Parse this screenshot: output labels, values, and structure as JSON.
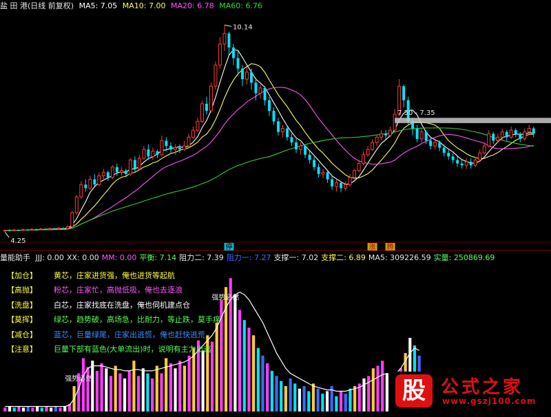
{
  "price_header": {
    "title": "盐 田 港(日线 前复权)",
    "ma5": "MA5: 7.05",
    "ma10": "MA10: 7.00",
    "ma20": "MA20: 6.78",
    "ma60": "MA60: 6.76"
  },
  "volume_header": {
    "title": "量能助手",
    "items": [
      {
        "text": "JJJ: 0.00",
        "color": "#e6e6e6"
      },
      {
        "text": "XX: 0.00",
        "color": "#e6e6e6"
      },
      {
        "text": "MM: 0.00",
        "color": "#ff55ff"
      },
      {
        "text": "平衡: 7.14",
        "color": "#55ff55"
      },
      {
        "text": "阻力二: 7.39",
        "color": "#e6e6e6"
      },
      {
        "text": "阻力一: 7.27",
        "color": "#3b6cff"
      },
      {
        "text": "支撑一: 7.02",
        "color": "#e6e6e6"
      },
      {
        "text": "支撑二: 6.89",
        "color": "#ffff55"
      },
      {
        "text": "MA5: 309226.59",
        "color": "#e6e6e6"
      },
      {
        "text": "实量: 250869.69",
        "color": "#55ff55"
      }
    ]
  },
  "legend": [
    {
      "tag": "【加仓】",
      "text": "黄芯，庄家进货强，俺也进货等起航",
      "color": "#ffff33"
    },
    {
      "tag": "【高抛】",
      "text": "粉芯，庄家忙，高抛低吸，俺也去逐浪",
      "color": "#ff55ff"
    },
    {
      "tag": "【洗盘】",
      "text": "白芯，庄家找底在洗盘，俺也伺机建点仓",
      "color": "#ffffff"
    },
    {
      "tag": "【莫挥】",
      "text": "绿芯，趋势破，高场急，比耐力，等止跌，莫手痒",
      "color": "#55ff55"
    },
    {
      "tag": "【减仓】",
      "text": "蓝芯，巨量绿尾，庄家出逃慌，俺也赶快逃荒",
      "color": "#3b8cff"
    },
    {
      "tag": "【注意】",
      "text": "巨量下部有蓝色(大单流出)时，说明有主力出逃",
      "color": "#55ff55"
    }
  ],
  "annotations": {
    "high_label": "10.14",
    "low_label": "4.25",
    "resistance_label": "7.50 - 7.35",
    "stop_mark": "停",
    "limit_marks": [
      "涨",
      "腾"
    ],
    "vol_note_1": "强势必然",
    "vol_note_2": "强势必然"
  },
  "logo": {
    "stamp": "股",
    "name": "公式之家",
    "url": "www.gszj100.com"
  },
  "colors": {
    "up": "#ff3c3c",
    "down": "#00e5ff",
    "ma5": "#ffffff",
    "ma10": "#ffff55",
    "ma20": "#ff55ff",
    "ma60": "#33cc33",
    "resistance": "#c8c8c8"
  },
  "chart_data": [
    {
      "type": "candlestick",
      "title": "盐 田 港(日线 前复权)",
      "ylim": [
        4.0,
        10.5
      ],
      "ma_periods": [
        5,
        10,
        20,
        60
      ],
      "resistance_band": [
        7.35,
        7.5
      ],
      "marked_high": 10.14,
      "marked_low": 4.25,
      "candles": [
        [
          4.28,
          4.3,
          4.32,
          4.25
        ],
        [
          4.3,
          4.29,
          4.33,
          4.27
        ],
        [
          4.29,
          4.31,
          4.34,
          4.27
        ],
        [
          4.31,
          4.3,
          4.33,
          4.28
        ],
        [
          4.3,
          4.32,
          4.35,
          4.28
        ],
        [
          4.32,
          4.31,
          4.34,
          4.29
        ],
        [
          4.31,
          4.33,
          4.36,
          4.29
        ],
        [
          4.33,
          4.32,
          4.35,
          4.3
        ],
        [
          4.32,
          4.34,
          4.37,
          4.3
        ],
        [
          4.34,
          4.33,
          4.36,
          4.31
        ],
        [
          4.33,
          4.35,
          4.38,
          4.31
        ],
        [
          4.35,
          4.34,
          4.37,
          4.32
        ],
        [
          4.34,
          4.36,
          4.39,
          4.32
        ],
        [
          4.36,
          4.35,
          4.38,
          4.33
        ],
        [
          4.35,
          4.4,
          4.43,
          4.33
        ],
        [
          4.4,
          4.8,
          4.85,
          4.38
        ],
        [
          4.8,
          5.25,
          5.3,
          4.75
        ],
        [
          5.25,
          5.6,
          5.7,
          5.2
        ],
        [
          5.6,
          5.5,
          5.75,
          5.4
        ],
        [
          5.5,
          5.75,
          5.85,
          5.45
        ],
        [
          5.75,
          5.6,
          5.9,
          5.55
        ],
        [
          5.6,
          5.85,
          5.95,
          5.55
        ],
        [
          5.85,
          5.95,
          6.05,
          5.7
        ],
        [
          5.95,
          5.8,
          6.0,
          5.7
        ],
        [
          5.8,
          6.1,
          6.15,
          5.75
        ],
        [
          6.1,
          5.95,
          6.2,
          5.85
        ],
        [
          5.95,
          6.0,
          6.1,
          5.85
        ],
        [
          6.0,
          5.9,
          6.05,
          5.8
        ],
        [
          5.9,
          6.3,
          6.35,
          5.85
        ],
        [
          6.3,
          6.05,
          6.4,
          5.95
        ],
        [
          6.05,
          6.35,
          6.45,
          6.0
        ],
        [
          6.35,
          6.6,
          6.7,
          6.3
        ],
        [
          6.6,
          6.4,
          6.75,
          6.3
        ],
        [
          6.4,
          6.55,
          6.65,
          6.3
        ],
        [
          6.55,
          6.45,
          6.6,
          6.35
        ],
        [
          6.45,
          6.85,
          7.0,
          6.4
        ],
        [
          6.85,
          6.7,
          6.95,
          6.55
        ],
        [
          6.7,
          6.6,
          6.8,
          6.5
        ],
        [
          6.6,
          6.65,
          6.75,
          6.45
        ],
        [
          6.65,
          6.6,
          6.75,
          6.5
        ],
        [
          6.6,
          6.7,
          6.85,
          6.55
        ],
        [
          6.7,
          6.95,
          7.05,
          6.65
        ],
        [
          6.95,
          7.15,
          7.25,
          6.9
        ],
        [
          7.15,
          7.4,
          7.5,
          7.1
        ],
        [
          7.4,
          7.9,
          8.0,
          7.35
        ],
        [
          7.9,
          7.7,
          8.1,
          7.6
        ],
        [
          7.7,
          8.4,
          8.5,
          7.65
        ],
        [
          8.4,
          9.0,
          9.1,
          8.3
        ],
        [
          9.0,
          9.6,
          9.8,
          8.9
        ],
        [
          9.6,
          9.9,
          10.14,
          9.4
        ],
        [
          9.9,
          9.5,
          9.95,
          9.3
        ],
        [
          9.5,
          9.2,
          9.6,
          9.0
        ],
        [
          9.2,
          8.9,
          9.4,
          8.7
        ],
        [
          8.9,
          8.6,
          9.0,
          8.4
        ],
        [
          8.6,
          8.8,
          8.95,
          8.45
        ],
        [
          8.8,
          8.5,
          8.9,
          8.3
        ],
        [
          8.5,
          8.2,
          8.6,
          8.0
        ],
        [
          8.2,
          8.35,
          8.45,
          8.05
        ],
        [
          8.35,
          8.0,
          8.4,
          7.85
        ],
        [
          8.0,
          7.7,
          8.1,
          7.55
        ],
        [
          7.7,
          7.4,
          7.8,
          7.3
        ],
        [
          7.4,
          7.1,
          7.5,
          7.0
        ],
        [
          7.1,
          7.2,
          7.3,
          6.95
        ],
        [
          7.2,
          6.95,
          7.25,
          6.85
        ],
        [
          6.95,
          6.8,
          7.05,
          6.7
        ],
        [
          6.8,
          6.6,
          6.9,
          6.5
        ],
        [
          6.6,
          6.7,
          6.8,
          6.45
        ],
        [
          6.7,
          6.45,
          6.75,
          6.35
        ],
        [
          6.45,
          6.3,
          6.55,
          6.2
        ],
        [
          6.3,
          6.1,
          6.4,
          6.0
        ],
        [
          6.1,
          5.9,
          6.2,
          5.8
        ],
        [
          5.9,
          5.95,
          6.05,
          5.78
        ],
        [
          5.95,
          5.75,
          6.0,
          5.65
        ],
        [
          5.75,
          5.55,
          5.85,
          5.45
        ],
        [
          5.55,
          5.65,
          5.75,
          5.4
        ],
        [
          5.65,
          5.5,
          5.7,
          5.38
        ],
        [
          5.5,
          5.6,
          5.7,
          5.42
        ],
        [
          5.6,
          5.8,
          5.9,
          5.55
        ],
        [
          5.8,
          6.0,
          6.05,
          5.75
        ],
        [
          6.0,
          6.2,
          6.3,
          5.95
        ],
        [
          6.2,
          6.45,
          6.55,
          6.15
        ],
        [
          6.45,
          6.6,
          6.7,
          6.4
        ],
        [
          6.6,
          6.8,
          6.9,
          6.55
        ],
        [
          6.8,
          6.95,
          7.0,
          6.7
        ],
        [
          6.95,
          7.05,
          7.15,
          6.85
        ],
        [
          7.05,
          7.0,
          7.15,
          6.9
        ],
        [
          7.0,
          7.15,
          7.25,
          6.95
        ],
        [
          7.15,
          7.6,
          7.75,
          7.1
        ],
        [
          7.6,
          8.4,
          8.6,
          7.55
        ],
        [
          8.4,
          8.0,
          8.45,
          7.8
        ],
        [
          8.0,
          7.4,
          8.1,
          7.3
        ],
        [
          7.4,
          7.2,
          7.5,
          7.0
        ],
        [
          7.2,
          6.9,
          7.3,
          6.8
        ],
        [
          6.9,
          7.1,
          7.2,
          6.8
        ],
        [
          7.1,
          6.85,
          7.15,
          6.75
        ],
        [
          6.85,
          6.7,
          6.95,
          6.6
        ],
        [
          6.7,
          6.8,
          6.9,
          6.6
        ],
        [
          6.8,
          6.65,
          6.85,
          6.55
        ],
        [
          6.65,
          6.5,
          6.75,
          6.4
        ],
        [
          6.5,
          6.4,
          6.6,
          6.3
        ],
        [
          6.4,
          6.3,
          6.5,
          6.2
        ],
        [
          6.3,
          6.2,
          6.4,
          6.1
        ],
        [
          6.2,
          6.15,
          6.3,
          6.05
        ],
        [
          6.15,
          6.25,
          6.35,
          6.05
        ],
        [
          6.25,
          6.15,
          6.35,
          6.05
        ],
        [
          6.15,
          6.3,
          6.4,
          6.1
        ],
        [
          6.3,
          6.5,
          6.6,
          6.25
        ],
        [
          6.5,
          6.7,
          6.8,
          6.45
        ],
        [
          6.7,
          7.05,
          7.15,
          6.65
        ],
        [
          7.05,
          6.85,
          7.1,
          6.75
        ],
        [
          6.85,
          6.95,
          7.05,
          6.8
        ],
        [
          6.95,
          7.1,
          7.2,
          6.85
        ],
        [
          7.1,
          6.95,
          7.15,
          6.85
        ],
        [
          6.95,
          7.15,
          7.25,
          6.9
        ],
        [
          7.15,
          7.05,
          7.2,
          6.95
        ],
        [
          7.05,
          6.9,
          7.1,
          6.8
        ],
        [
          6.9,
          7.1,
          7.2,
          6.85
        ],
        [
          7.1,
          7.2,
          7.3,
          7.0
        ],
        [
          7.2,
          7.05,
          7.25,
          6.95
        ]
      ]
    },
    {
      "type": "bar",
      "title": "量能助手",
      "ylim": [
        0,
        110
      ],
      "bars": [
        [
          3,
          "#ff3cff"
        ],
        [
          4,
          "#ffffff"
        ],
        [
          3,
          "#00e5ff"
        ],
        [
          4,
          "#ff3cff"
        ],
        [
          3,
          "#ffffff"
        ],
        [
          4,
          "#3b6cff"
        ],
        [
          3,
          "#ff3cff"
        ],
        [
          4,
          "#ffffff"
        ],
        [
          3,
          "#00e5ff"
        ],
        [
          4,
          "#ff3cff"
        ],
        [
          3,
          "#ffffff"
        ],
        [
          4,
          "#3b6cff"
        ],
        [
          3,
          "#ff3cff"
        ],
        [
          4,
          "#ffffff"
        ],
        [
          6,
          "#ff3cff"
        ],
        [
          20,
          "#ffcc33"
        ],
        [
          30,
          "#ff3cff"
        ],
        [
          42,
          "#ff3cff"
        ],
        [
          35,
          "#ff3cff"
        ],
        [
          40,
          "#ffffff"
        ],
        [
          32,
          "#ff3cff"
        ],
        [
          38,
          "#ff3cff"
        ],
        [
          34,
          "#ffffff"
        ],
        [
          28,
          "#ff3cff"
        ],
        [
          36,
          "#ffcc33"
        ],
        [
          30,
          "#ff3cff"
        ],
        [
          26,
          "#ffffff"
        ],
        [
          32,
          "#ff3cff"
        ],
        [
          40,
          "#ffcc33"
        ],
        [
          28,
          "#ff3cff"
        ],
        [
          34,
          "#ffffff"
        ],
        [
          30,
          "#00e5ff"
        ],
        [
          26,
          "#ff3cff"
        ],
        [
          36,
          "#ffcc33"
        ],
        [
          30,
          "#ff3cff"
        ],
        [
          42,
          "#ffcc33"
        ],
        [
          38,
          "#ff3cff"
        ],
        [
          34,
          "#ffffff"
        ],
        [
          40,
          "#ff3cff"
        ],
        [
          36,
          "#ffcc33"
        ],
        [
          44,
          "#ff3cff"
        ],
        [
          50,
          "#ffcc33"
        ],
        [
          56,
          "#ff3cff"
        ],
        [
          48,
          "#ffffff"
        ],
        [
          60,
          "#ffcc33"
        ],
        [
          55,
          "#ff3cff"
        ],
        [
          70,
          "#ffcc33"
        ],
        [
          88,
          "#ff3cff"
        ],
        [
          98,
          "#ffcc33"
        ],
        [
          105,
          "#ff3cff"
        ],
        [
          92,
          "#ffffff"
        ],
        [
          80,
          "#ff3cff"
        ],
        [
          72,
          "#00e5ff"
        ],
        [
          66,
          "#ff3cff"
        ],
        [
          60,
          "#ffcc33"
        ],
        [
          50,
          "#00e5ff"
        ],
        [
          44,
          "#3b6cff"
        ],
        [
          38,
          "#ff3cff"
        ],
        [
          32,
          "#00e5ff"
        ],
        [
          28,
          "#3b6cff"
        ],
        [
          24,
          "#00e5ff"
        ],
        [
          20,
          "#ffcc33"
        ],
        [
          26,
          "#3b6cff"
        ],
        [
          22,
          "#00e5ff"
        ],
        [
          18,
          "#ffffff"
        ],
        [
          20,
          "#3b6cff"
        ],
        [
          16,
          "#00e5ff"
        ],
        [
          22,
          "#ffcc33"
        ],
        [
          18,
          "#3b6cff"
        ],
        [
          14,
          "#00e5ff"
        ],
        [
          16,
          "#ffffff"
        ],
        [
          20,
          "#3b6cff"
        ],
        [
          12,
          "#00e5ff"
        ],
        [
          16,
          "#ff3cff"
        ],
        [
          14,
          "#3b6cff"
        ],
        [
          18,
          "#00e5ff"
        ],
        [
          20,
          "#ffcc33"
        ],
        [
          22,
          "#ff3cff"
        ],
        [
          26,
          "#ffffff"
        ],
        [
          28,
          "#ff3cff"
        ],
        [
          34,
          "#ffcc33"
        ],
        [
          36,
          "#ff3cff"
        ],
        [
          40,
          "#ff3cff"
        ],
        [
          30,
          "#ffffff"
        ],
        [
          24,
          "#3b6cff"
        ],
        [
          28,
          "#ffcc33"
        ],
        [
          34,
          "#ff3cff"
        ],
        [
          46,
          "#ffcc33"
        ],
        [
          58,
          "#ffffff"
        ],
        [
          52,
          "#00e5ff"
        ],
        [
          44,
          "#3b6cff"
        ]
      ],
      "line": [
        4,
        4,
        4,
        4,
        4,
        4,
        4,
        4,
        4,
        4,
        4,
        4,
        4,
        4,
        5,
        10,
        18,
        28,
        34,
        36,
        36,
        36,
        35,
        34,
        33,
        33,
        32,
        32,
        33,
        33,
        32,
        32,
        32,
        33,
        34,
        35,
        36,
        37,
        38,
        39,
        41,
        44,
        48,
        52,
        56,
        60,
        66,
        74,
        82,
        88,
        92,
        94,
        92,
        88,
        82,
        76,
        70,
        62,
        54,
        46,
        40,
        34,
        30,
        28,
        26,
        24,
        22,
        20,
        19,
        18,
        17,
        17,
        16,
        16,
        16,
        17,
        18,
        19,
        21,
        23,
        25,
        27,
        29,
        30,
        29,
        30,
        34,
        40,
        46,
        50,
        48
      ]
    }
  ]
}
